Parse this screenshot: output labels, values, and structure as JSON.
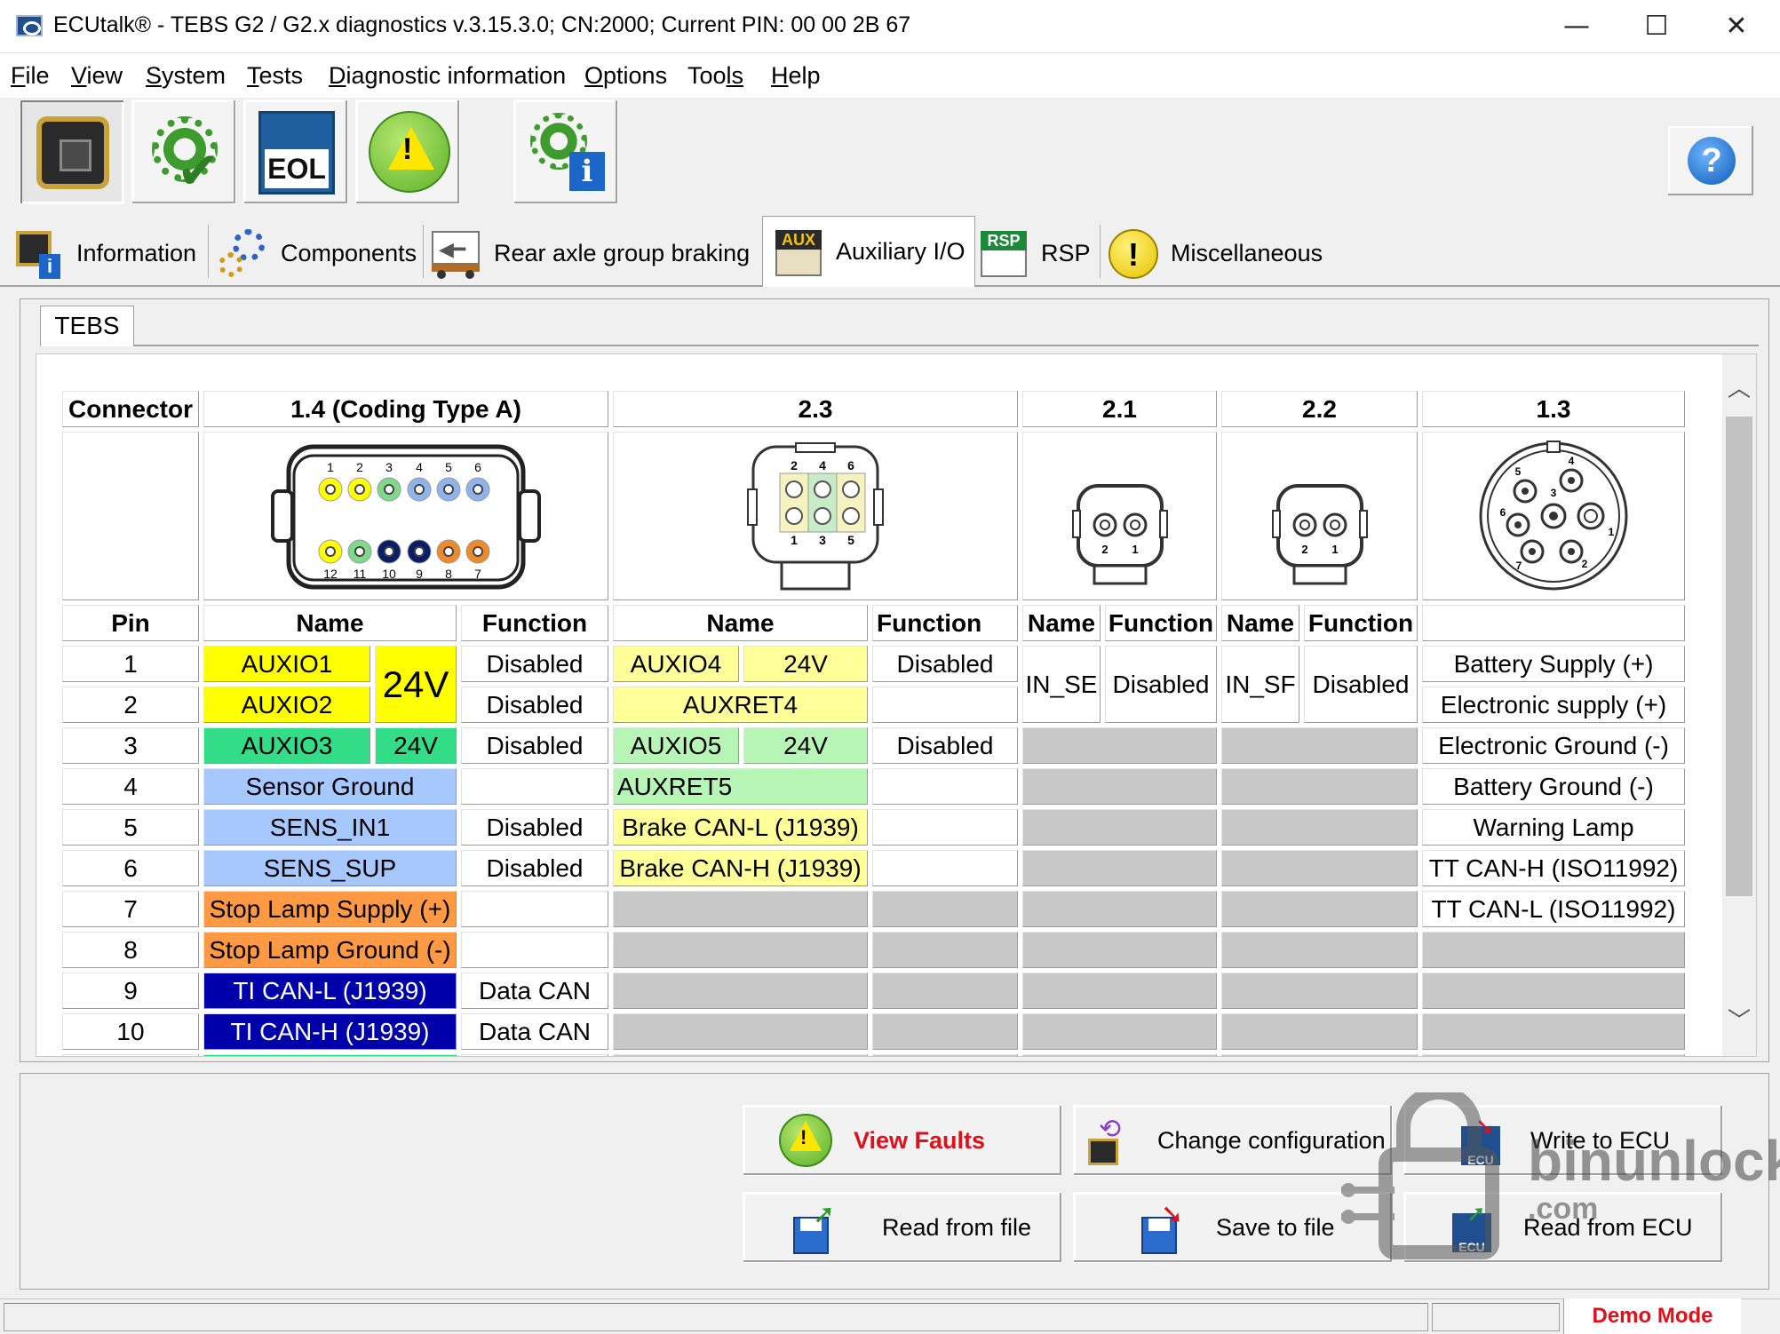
{
  "window": {
    "title": "ECUtalk® - TEBS G2 / G2.x diagnostics v.3.15.3.0; CN:2000; Current PIN: 00 00 2B 67",
    "minimize": "—",
    "maximize": "☐",
    "close": "✕"
  },
  "menu": [
    {
      "first": "F",
      "rest": "ile"
    },
    {
      "first": "V",
      "rest": "iew"
    },
    {
      "first": "S",
      "rest": "ystem"
    },
    {
      "first": "T",
      "rest": "ests"
    },
    {
      "first": "D",
      "rest": "iagnostic information"
    },
    {
      "first": "O",
      "rest": "ptions"
    },
    {
      "first": "Too",
      "rest": "ls"
    },
    {
      "first": "H",
      "rest": "elp"
    }
  ],
  "toolbar": {
    "eol_label": "EOL",
    "info_mark": "i",
    "warn_mark": "!",
    "help_mark": "?"
  },
  "tabs": {
    "information": "Information",
    "components": "Components",
    "rear_axle": "Rear axle group braking",
    "aux": "Auxiliary I/O",
    "aux_icon_text": "AUX",
    "rsp": "RSP",
    "rsp_icon_text": "RSP",
    "misc": "Miscellaneous",
    "misc_icon_text": "!"
  },
  "subtab": "TEBS",
  "table": {
    "connector_label": "Connector",
    "connectors": [
      "1.4 (Coding Type A)",
      "2.3",
      "2.1",
      "2.2",
      "1.3"
    ],
    "pin_label": "Pin",
    "name_label": "Name",
    "function_label": "Function",
    "c14": {
      "top_pins": [
        "1",
        "2",
        "3",
        "4",
        "5",
        "6"
      ],
      "bottom_pins": [
        "12",
        "11",
        "10",
        "9",
        "8",
        "7"
      ]
    },
    "c23": {
      "top_pins": [
        "2",
        "4",
        "6"
      ],
      "bottom_pins": [
        "1",
        "3",
        "5"
      ]
    },
    "c21": {
      "pins": [
        "2",
        "1"
      ]
    },
    "c22": {
      "pins": [
        "2",
        "1"
      ]
    },
    "c13": {
      "pins": [
        "5",
        "4",
        "6",
        "3",
        "7",
        "1",
        "2"
      ]
    },
    "rows": {
      "r1": {
        "pin": "1",
        "c14_name": "AUXIO1",
        "c14_volt": "24V",
        "c14_fn": "Disabled",
        "c23_name": "AUXIO4",
        "c23_volt": "24V",
        "c23_fn": "Disabled",
        "c13": "Battery Supply (+)"
      },
      "r2": {
        "pin": "2",
        "c14_name": "AUXIO2",
        "c14_fn": "Disabled",
        "c23_name": "AUXRET4",
        "c13": "Electronic supply (+)"
      },
      "r3": {
        "pin": "3",
        "c14_name": "AUXIO3",
        "c14_volt": "24V",
        "c14_fn": "Disabled",
        "c23_name": "AUXIO5",
        "c23_volt": "24V",
        "c23_fn": "Disabled",
        "c13": "Electronic Ground (-)"
      },
      "r4": {
        "pin": "4",
        "c14_name": "Sensor Ground",
        "c23_name": "AUXRET5",
        "c13": "Battery Ground (-)"
      },
      "r5": {
        "pin": "5",
        "c14_name": "SENS_IN1",
        "c14_fn": "Disabled",
        "c23_name": "Brake CAN-L (J1939)",
        "c13": "Warning Lamp"
      },
      "r6": {
        "pin": "6",
        "c14_name": "SENS_SUP",
        "c14_fn": "Disabled",
        "c23_name": "Brake CAN-H (J1939)",
        "c13": "TT CAN-H (ISO11992)"
      },
      "r7": {
        "pin": "7",
        "c14_name": "Stop Lamp Supply (+)",
        "c13": "TT CAN-L (ISO11992)"
      },
      "r8": {
        "pin": "8",
        "c14_name": "Stop Lamp Ground (-)"
      },
      "r9": {
        "pin": "9",
        "c14_name": "TI CAN-L (J1939)",
        "c14_fn": "Data CAN"
      },
      "r10": {
        "pin": "10",
        "c14_name": "TI CAN-H (J1939)",
        "c14_fn": "Data CAN"
      }
    },
    "c21_name": "IN_SE",
    "c21_fn": "Disabled",
    "c22_name": "IN_SF",
    "c22_fn": "Disabled"
  },
  "scroll": {
    "up": "︿",
    "down": "﹀"
  },
  "actions": {
    "view_faults": "View Faults",
    "change_config": "Change configuration",
    "write_ecu": "Write to ECU",
    "read_file": "Read from file",
    "save_file": "Save to file",
    "read_ecu": "Read from ECU",
    "ecu_tag": "ECU"
  },
  "status": {
    "demo_mode": "Demo Mode"
  },
  "watermark": {
    "brand": "binunlock",
    "sub": ".com"
  }
}
